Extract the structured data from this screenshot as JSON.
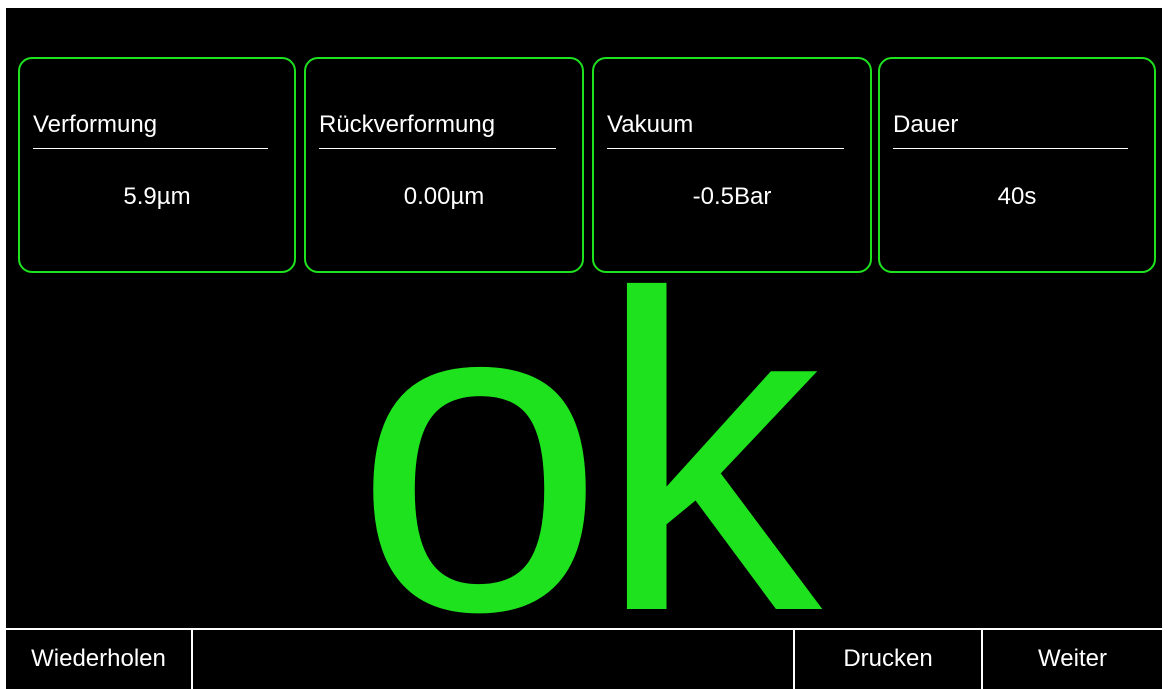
{
  "colors": {
    "accent": "#1ee21e",
    "background": "#000000",
    "text": "#ffffff"
  },
  "cards": [
    {
      "label": "Verformung",
      "value": "5.9µm"
    },
    {
      "label": "Rückverformung",
      "value": "0.00µm"
    },
    {
      "label": "Vakuum",
      "value": "-0.5Bar"
    },
    {
      "label": "Dauer",
      "value": "40s"
    }
  ],
  "result": {
    "text": "ok"
  },
  "buttons": {
    "repeat": "Wiederholen",
    "empty": "",
    "print": "Drucken",
    "next": "Weiter"
  }
}
